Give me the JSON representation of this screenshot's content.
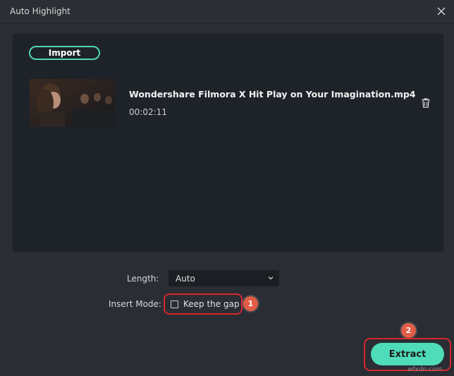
{
  "window": {
    "title": "Auto Highlight"
  },
  "panel": {
    "import_label": "Import",
    "file": {
      "name": "Wondershare Filmora X  Hit Play on Your Imagination.mp4",
      "duration": "00:02:11"
    }
  },
  "settings": {
    "length_label": "Length:",
    "length_value": "Auto",
    "insert_mode_label": "Insert Mode:",
    "keep_gap_label": "Keep the gap",
    "keep_gap_checked": false
  },
  "annotations": {
    "badge_1": "1",
    "badge_2": "2"
  },
  "footer": {
    "extract_label": "Extract",
    "watermark": "wfxdn.com"
  },
  "colors": {
    "accent": "#4fdcb9",
    "highlight_outline": "#d8262e",
    "badge": "#e25d45"
  }
}
